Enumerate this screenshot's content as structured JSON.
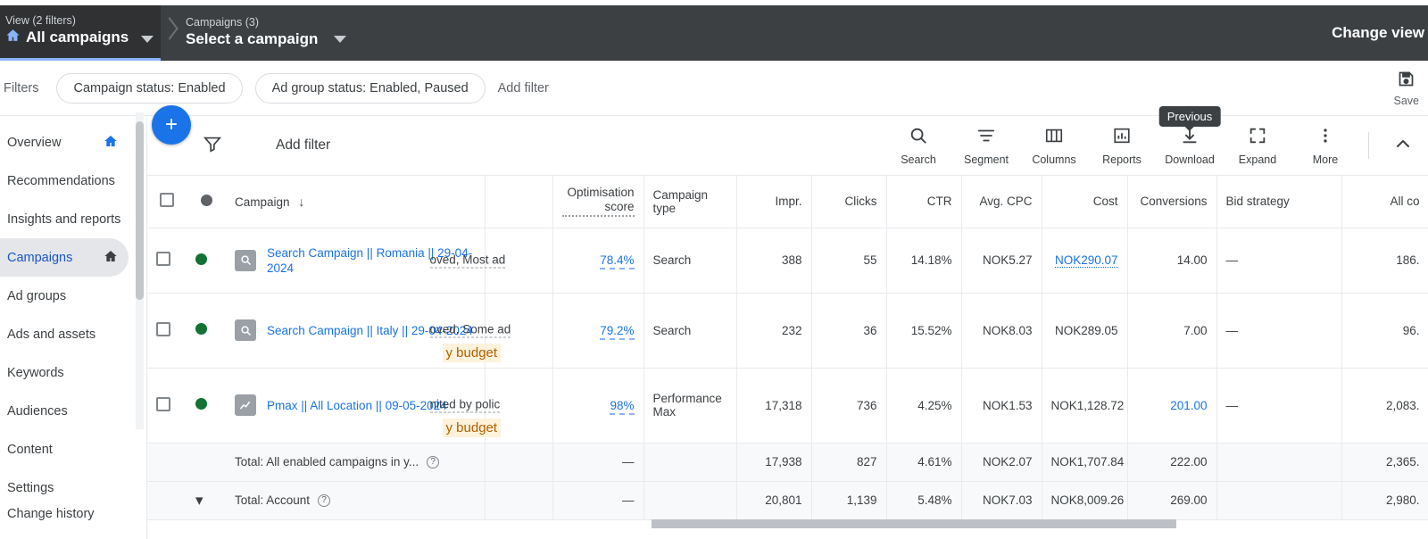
{
  "topbar": {
    "view_sub": "View (2 filters)",
    "view_main": "All campaigns",
    "campaign_sub": "Campaigns (3)",
    "campaign_main": "Select a campaign",
    "change_view": "Change view"
  },
  "filterbar": {
    "label": "Filters",
    "chips": [
      "Campaign status: Enabled",
      "Ad group status: Enabled, Paused"
    ],
    "add_filter": "Add filter",
    "save_label": "Save"
  },
  "sidebar": {
    "items": [
      {
        "label": "Overview",
        "icon": "home-icon",
        "active": false
      },
      {
        "label": "Recommendations",
        "icon": "",
        "active": false
      },
      {
        "label": "Insights and reports",
        "icon": "",
        "active": false
      },
      {
        "label": "Campaigns",
        "icon": "home-icon",
        "active": true
      },
      {
        "label": "Ad groups",
        "icon": "",
        "active": false
      },
      {
        "label": "Ads and assets",
        "icon": "",
        "active": false
      },
      {
        "label": "Keywords",
        "icon": "",
        "active": false
      },
      {
        "label": "Audiences",
        "icon": "",
        "active": false
      },
      {
        "label": "Content",
        "icon": "",
        "active": false
      },
      {
        "label": "Settings",
        "icon": "",
        "active": false
      },
      {
        "label": "Change history",
        "icon": "",
        "active": false
      }
    ]
  },
  "toolbar": {
    "add_filter": "Add filter",
    "actions": [
      {
        "label": "Search",
        "icon": "search-icon"
      },
      {
        "label": "Segment",
        "icon": "segment-icon"
      },
      {
        "label": "Columns",
        "icon": "columns-icon"
      },
      {
        "label": "Reports",
        "icon": "reports-icon"
      },
      {
        "label": "Download",
        "icon": "download-icon"
      },
      {
        "label": "Expand",
        "icon": "expand-icon"
      },
      {
        "label": "More",
        "icon": "more-vert-icon"
      }
    ],
    "tooltip": "Previous"
  },
  "table": {
    "headers": {
      "campaign": "Campaign",
      "optimisation_score": "Optimisation score",
      "campaign_type": "Campaign type",
      "impr": "Impr.",
      "clicks": "Clicks",
      "ctr": "CTR",
      "avg_cpc": "Avg. CPC",
      "cost": "Cost",
      "conversions": "Conversions",
      "bid_strategy": "Bid strategy",
      "all_conv": "All co"
    },
    "rows": [
      {
        "name": "Search Campaign || Romania || 29-04-2024",
        "type_icon": "search-campaign-icon",
        "status": "enabled",
        "budget_fragment": "oved, Most ad",
        "budget_fragment2": "",
        "optimisation_score": "78.4%",
        "campaign_type": "Search",
        "impr": "388",
        "clicks": "55",
        "ctr": "14.18%",
        "avg_cpc": "NOK5.27",
        "cost": "NOK290.07",
        "cost_link": true,
        "conversions": "14.00",
        "conversions_link": false,
        "bid_strategy": "—",
        "all_conv": "186."
      },
      {
        "name": "Search Campaign || Italy || 29-04-2024",
        "type_icon": "search-campaign-icon",
        "status": "enabled",
        "budget_fragment": "oved, Some ad",
        "budget_fragment2": "y budget",
        "optimisation_score": "79.2%",
        "campaign_type": "Search",
        "impr": "232",
        "clicks": "36",
        "ctr": "15.52%",
        "avg_cpc": "NOK8.03",
        "cost": "NOK289.05",
        "cost_link": false,
        "conversions": "7.00",
        "conversions_link": false,
        "bid_strategy": "—",
        "all_conv": "96."
      },
      {
        "name": "Pmax || All Location || 09-05-2024",
        "type_icon": "performance-max-icon",
        "status": "enabled",
        "budget_fragment": "nited by polic",
        "budget_fragment2": "y budget",
        "optimisation_score": "98%",
        "campaign_type": "Performance Max",
        "impr": "17,318",
        "clicks": "736",
        "ctr": "4.25%",
        "avg_cpc": "NOK1.53",
        "cost": "NOK1,128.72",
        "cost_link": false,
        "conversions": "201.00",
        "conversions_link": true,
        "bid_strategy": "—",
        "all_conv": "2,083."
      }
    ],
    "totals": [
      {
        "label": "Total: All enabled campaigns in y...",
        "optimisation_score": "—",
        "campaign_type": "",
        "impr": "17,938",
        "clicks": "827",
        "ctr": "4.61%",
        "avg_cpc": "NOK2.07",
        "cost": "NOK1,707.84",
        "conversions": "222.00",
        "bid_strategy": "",
        "all_conv": "2,365."
      },
      {
        "label": "Total: Account",
        "optimisation_score": "—",
        "campaign_type": "",
        "impr": "20,801",
        "clicks": "1,139",
        "ctr": "5.48%",
        "avg_cpc": "NOK7.03",
        "cost": "NOK8,009.26",
        "conversions": "269.00",
        "bid_strategy": "",
        "all_conv": "2,980."
      }
    ]
  },
  "colors": {
    "accent": "#1a73e8",
    "topbar": "#3c4043",
    "enabled": "#137333",
    "budget_warn": "#b06000"
  }
}
